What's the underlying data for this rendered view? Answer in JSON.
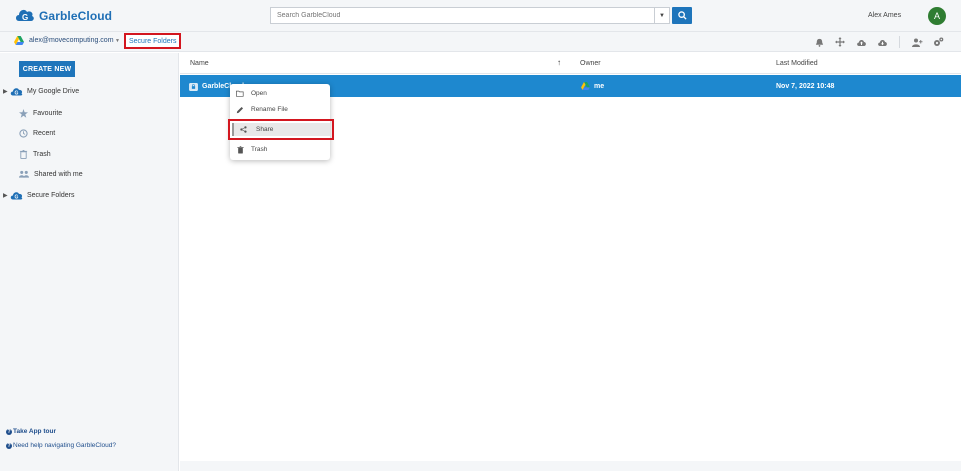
{
  "header": {
    "logo_text": "GarbleCloud",
    "search_placeholder": "Search GarbleCloud",
    "user_name": "Alex Ames",
    "avatar_letter": "A"
  },
  "subbar": {
    "account_email": "alex@movecomputing.com",
    "breadcrumb": "Secure Folders"
  },
  "sidebar": {
    "create_button": "CREATE NEW",
    "roots": [
      {
        "label": "My Google Drive",
        "icon": "garblecloud-icon"
      },
      {
        "label": "Secure Folders",
        "icon": "garblecloud-icon"
      }
    ],
    "items": [
      {
        "label": "Favourite",
        "icon": "star-icon"
      },
      {
        "label": "Recent",
        "icon": "clock-icon"
      },
      {
        "label": "Trash",
        "icon": "trash-icon"
      },
      {
        "label": "Shared with me",
        "icon": "people-icon"
      }
    ],
    "help": {
      "tour": "Take App tour",
      "navigate": "Need help navigating GarbleCloud?"
    }
  },
  "table": {
    "columns": {
      "name": "Name",
      "owner": "Owner",
      "modified": "Last Modified"
    },
    "sort": "ascending",
    "rows": [
      {
        "name": "GarbleCloud",
        "owner": "me",
        "modified": "Nov 7, 2022 10:48"
      }
    ]
  },
  "context_menu": {
    "items": [
      {
        "label": "Open",
        "icon": "folder-open-icon"
      },
      {
        "label": "Rename File",
        "icon": "pencil-icon"
      },
      {
        "label": "Share",
        "icon": "share-icon"
      },
      {
        "label": "Trash",
        "icon": "trash-icon"
      }
    ]
  },
  "colors": {
    "brand": "#1e75bb",
    "selected_row": "#1e88cf",
    "highlight": "#d3161f"
  }
}
